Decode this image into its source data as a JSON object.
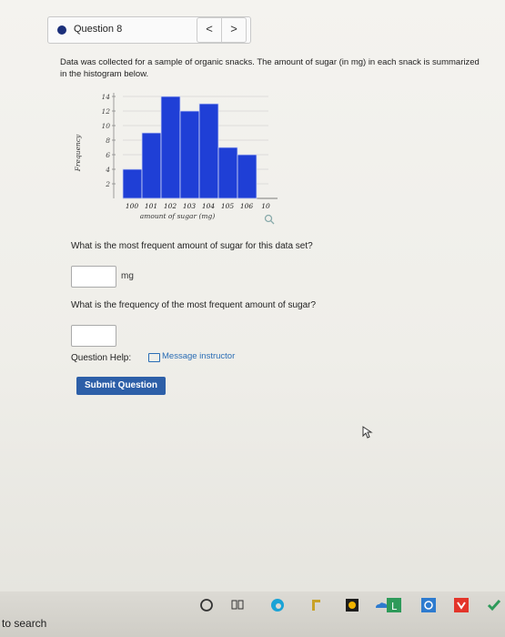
{
  "question_nav": {
    "label": "Question 8",
    "prev": "<",
    "next": ">"
  },
  "question": {
    "text": "Data was collected for a sample of organic snacks. The amount of sugar (in mg) in each snack is summarized in the histogram below.",
    "sub1": "What is the most frequent amount of sugar for this data set?",
    "unit": "mg",
    "sub2": "What is the frequency of the most frequent amount of sugar?"
  },
  "answers": {
    "a1": "",
    "a2": ""
  },
  "help": {
    "label": "Question Help:",
    "link": "Message instructor"
  },
  "submit_label": "Submit Question",
  "taskbar": {
    "search": "to search"
  },
  "chart_data": {
    "type": "bar",
    "categories": [
      "100",
      "101",
      "102",
      "103",
      "104",
      "105"
    ],
    "values": [
      4,
      9,
      14,
      12,
      13,
      7,
      6
    ],
    "x": [
      100,
      101,
      102,
      103,
      104,
      105,
      106
    ],
    "tick_labels_x": [
      "100",
      "101",
      "102",
      "103",
      "104",
      "105",
      "106",
      "10"
    ],
    "tick_labels_y": [
      "2",
      "4",
      "6",
      "8",
      "10",
      "12",
      "14"
    ],
    "ylabel": "Frequency",
    "xlabel": "amount of sugar (mg)",
    "ylim": [
      0,
      14
    ],
    "bar_color": "#1f3fd6",
    "grid": true
  }
}
